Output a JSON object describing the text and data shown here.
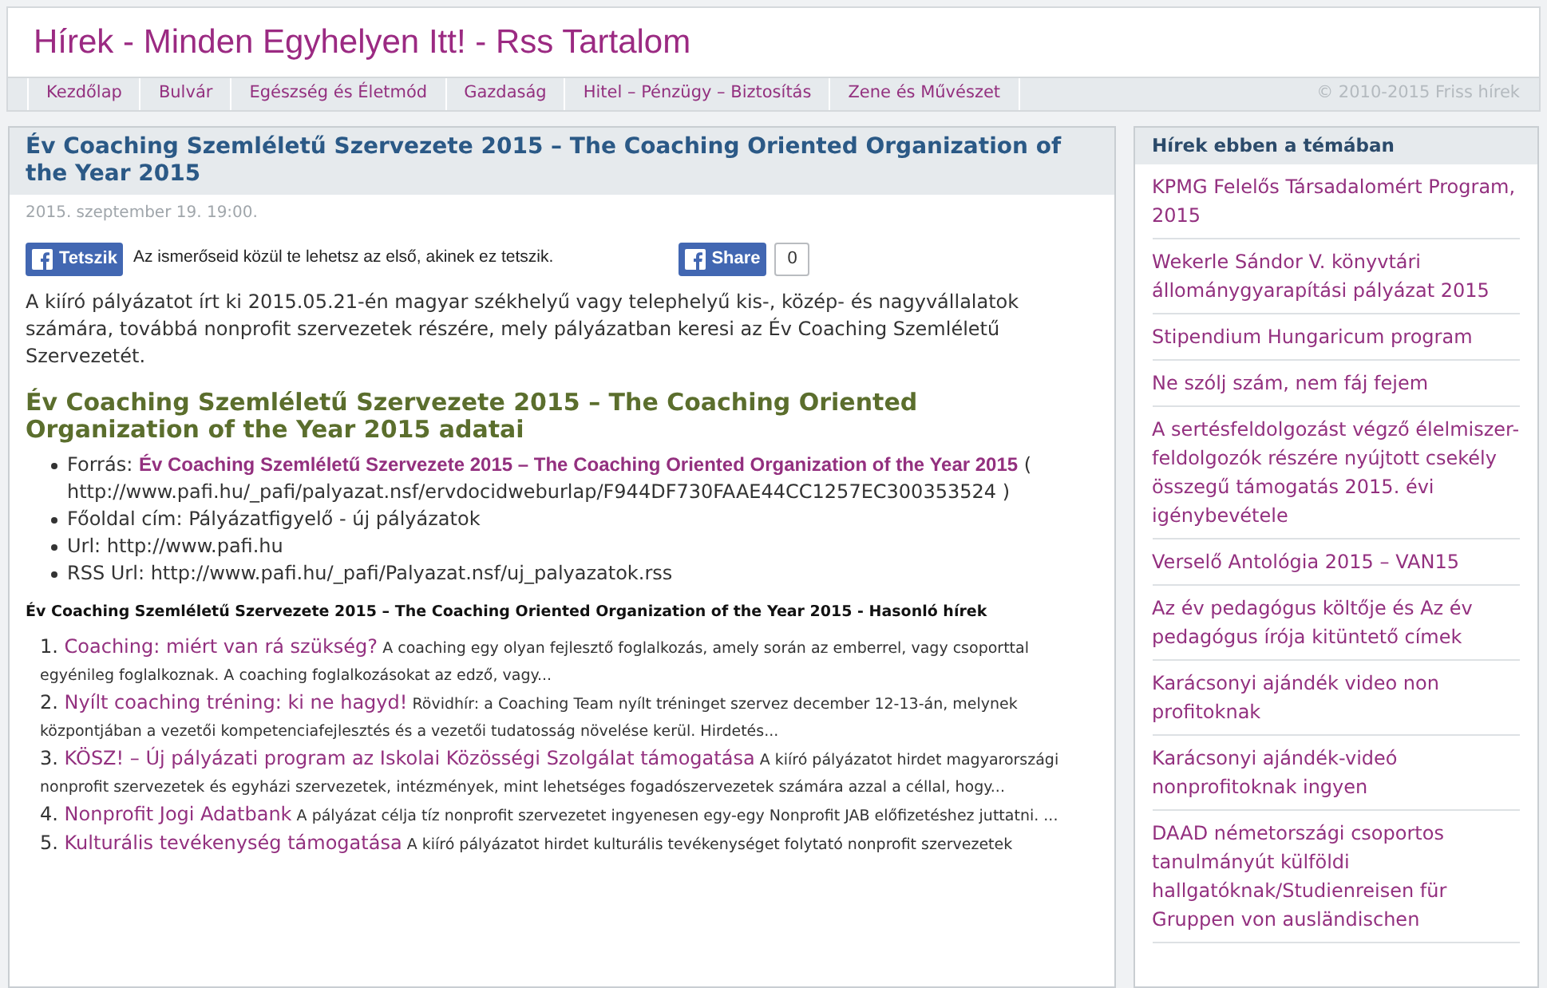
{
  "site": {
    "title": "Hírek - Minden Egyhelyen Itt! - Rss Tartalom"
  },
  "nav": {
    "items": [
      {
        "label": "Kezdőlap"
      },
      {
        "label": "Bulvár"
      },
      {
        "label": "Egészség és Életmód"
      },
      {
        "label": "Gazdaság"
      },
      {
        "label": "Hitel – Pénzügy – Biztosítás"
      },
      {
        "label": "Zene és Művészet"
      }
    ],
    "copyright": "© 2010-2015 Friss hírek"
  },
  "article": {
    "title": "Év Coaching Szemléletű Szervezete 2015 – The Coaching Oriented Organization of the Year 2015",
    "date": "2015. szeptember 19. 19:00.",
    "like_button": "Tetszik",
    "like_text": "Az ismerőseid közül te lehetsz az első, akinek ez tetszik.",
    "share_button": "Share",
    "share_count": "0",
    "intro": "A kiíró pályázatot írt ki 2015.05.21-én magyar székhelyű vagy telephelyű kis-, közép- és nagyvállalatok számára, továbbá nonprofit szervezetek részére, mely pályázatban keresi az Év Coaching Szemléletű Szervezetét.",
    "section_heading": "Év Coaching Szemléletű Szervezete 2015 – The Coaching Oriented Organization of the Year 2015 adatai",
    "details": [
      {
        "kind": "link",
        "label": "Forrás:",
        "link": "Év Coaching Szemléletű Szervezete 2015 – The Coaching Oriented Organization of the Year 2015",
        "value": "( http://www.pafi.hu/_pafi/palyazat.nsf/ervdocidweburlap/F944DF730FAAE44CC1257EC300353524 )"
      },
      {
        "kind": "text",
        "label": "Főoldal cím:",
        "value": "Pályázatfigyelő - új pályázatok"
      },
      {
        "kind": "text",
        "label": "Url:",
        "value": "http://www.pafi.hu"
      },
      {
        "kind": "text",
        "label": "RSS Url:",
        "value": "http://www.pafi.hu/_pafi/Palyazat.nsf/uj_palyazatok.rss"
      }
    ],
    "similar_heading": "Év Coaching Szemléletű Szervezete 2015 – The Coaching Oriented Organization of the Year 2015 - Hasonló hírek",
    "similar": [
      {
        "number": "1.",
        "title": "Coaching: miért van rá szükség?",
        "summary": "A coaching egy olyan fejlesztő foglalkozás, amely során az emberrel, vagy csoporttal egyénileg foglalkoznak. A coaching foglalkozásokat az edző, vagy..."
      },
      {
        "number": "2.",
        "title": "Nyílt coaching tréning: ki ne hagyd!",
        "summary": "Rövidhír: a Coaching Team nyílt tréninget szervez december 12-13-án, melynek központjában a vezetői kompetenciafejlesztés és a vezetői tudatosság növelése kerül. Hirdetés..."
      },
      {
        "number": "3.",
        "title": "KÖSZ! – Új pályázati program az Iskolai Közösségi Szolgálat támogatása",
        "summary": "A kiíró pályázatot hirdet magyarországi nonprofit szervezetek és egyházi szervezetek, intézmények, mint lehetséges fogadószervezetek számára azzal a céllal, hogy..."
      },
      {
        "number": "4.",
        "title": "Nonprofit Jogi Adatbank",
        "summary": "A pályázat célja tíz nonprofit szervezetet ingyenesen egy-egy Nonprofit JAB előfizetéshez juttatni. ..."
      },
      {
        "number": "5.",
        "title": "Kulturális tevékenység támogatása",
        "summary": "A kiíró pályázatot hirdet kulturális tevékenységet folytató nonprofit szervezetek"
      }
    ]
  },
  "sidebar": {
    "heading": "Hírek ebben a témában",
    "items": [
      "KPMG Felelős Társadalomért Program, 2015",
      "Wekerle Sándor V. könyvtári állománygyarapítási pályázat 2015",
      "Stipendium Hungaricum program",
      "Ne szólj szám, nem fáj fejem",
      "A sertésfeldolgozást végző élelmiszer-feldolgozók részére nyújtott csekély összegű támogatás 2015. évi igénybevétele",
      "Verselő Antológia 2015 – VAN15",
      "Az év pedagógus költője és Az év pedagógus írója kitüntető címek",
      "Karácsonyi ajándék video non profitoknak",
      "Karácsonyi ajándék-videó nonprofitoknak ingyen",
      "DAAD németországi csoportos tanulmányút külföldi hallgatóknak/Studienreisen für Gruppen von ausländischen"
    ]
  }
}
